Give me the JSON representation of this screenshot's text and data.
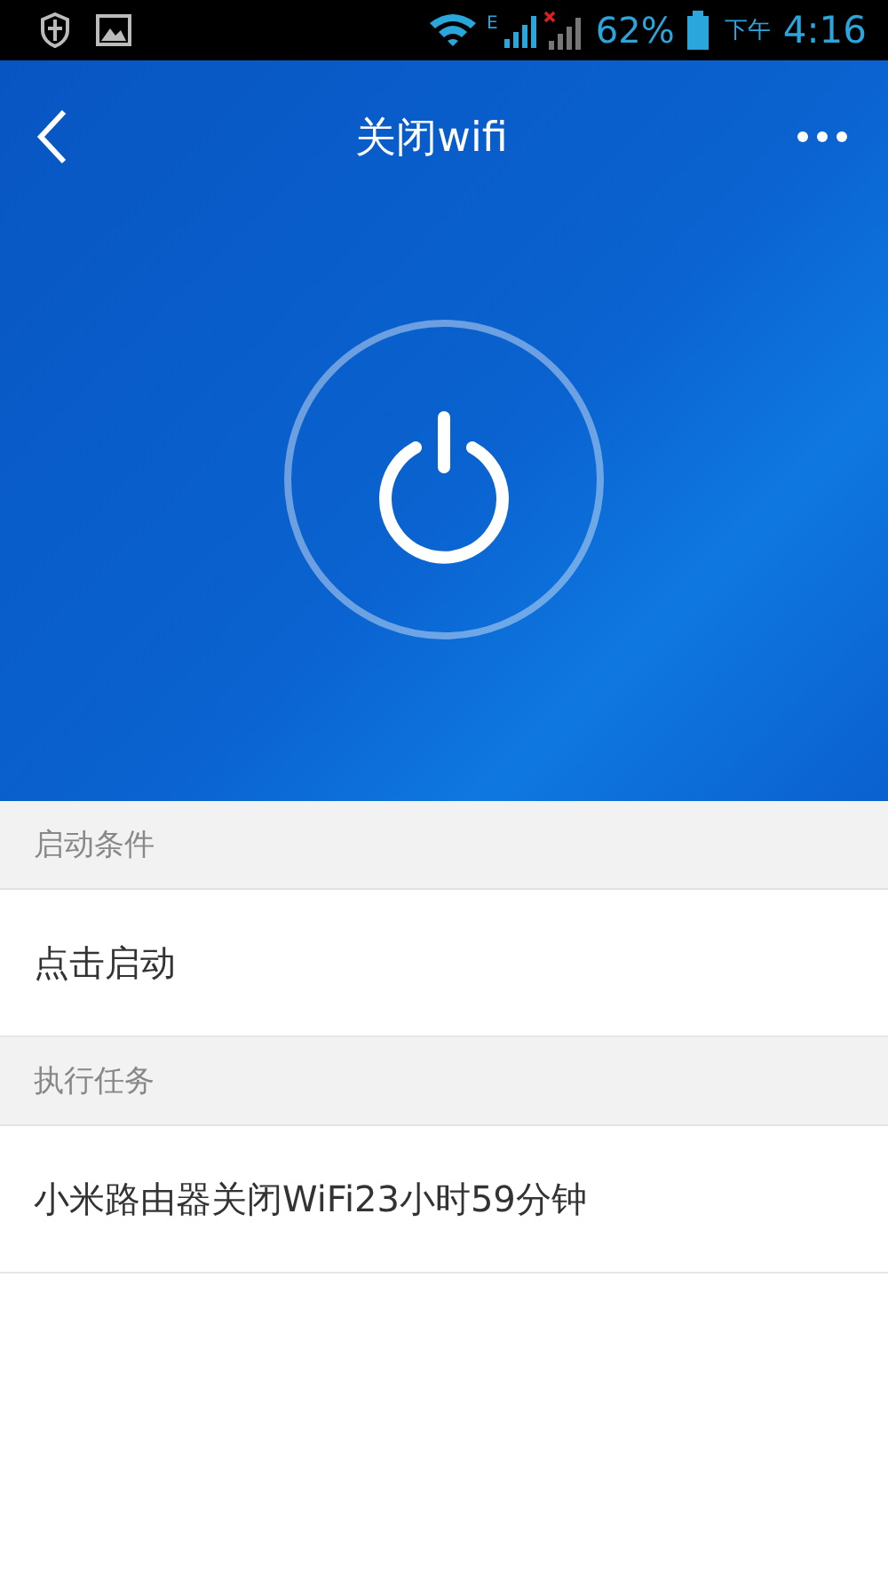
{
  "status_bar": {
    "network_type": "E",
    "battery": "62%",
    "period": "下午",
    "time": "4:16"
  },
  "header": {
    "title": "关闭wifi"
  },
  "sections": [
    {
      "title": "启动条件",
      "items": [
        "点击启动"
      ]
    },
    {
      "title": "执行任务",
      "items": [
        "小米路由器关闭WiFi23小时59分钟"
      ]
    }
  ]
}
